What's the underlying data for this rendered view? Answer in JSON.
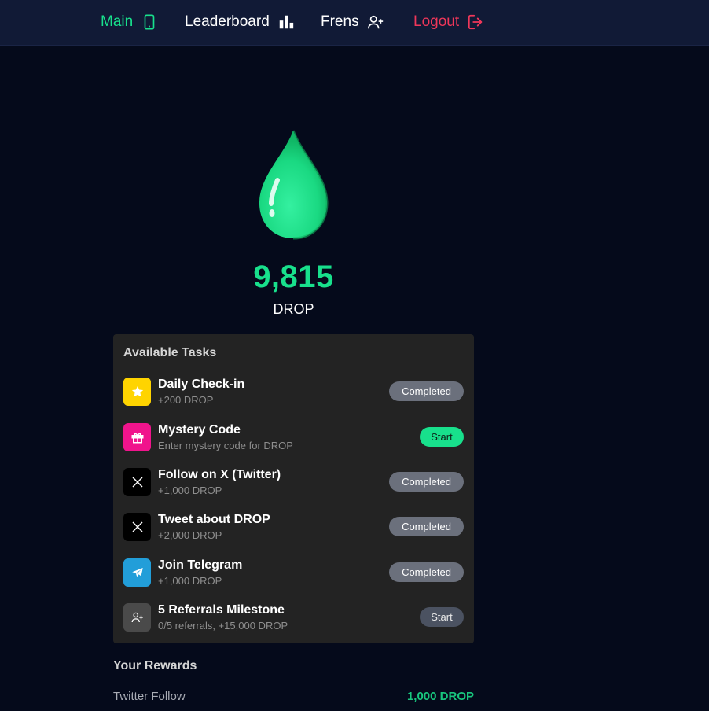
{
  "nav": {
    "main": "Main",
    "leaderboard": "Leaderboard",
    "frens": "Frens",
    "logout": "Logout"
  },
  "balance": {
    "amount": "9,815",
    "unit": "DROP"
  },
  "tasks": {
    "title": "Available Tasks",
    "items": [
      {
        "name": "Daily Check-in",
        "reward": "+200 DROP",
        "button": "Completed",
        "icon": "star-icon",
        "color": "#ffd400"
      },
      {
        "name": "Mystery Code",
        "reward": "Enter mystery code for DROP",
        "button": "Start",
        "icon": "gift-icon",
        "color": "#f0148c"
      },
      {
        "name": "Follow on X (Twitter)",
        "reward": "+1,000 DROP",
        "button": "Completed",
        "icon": "x-logo-icon",
        "color": "#000000"
      },
      {
        "name": "Tweet about DROP",
        "reward": "+2,000 DROP",
        "button": "Completed",
        "icon": "x-logo-icon",
        "color": "#000000"
      },
      {
        "name": "Join Telegram",
        "reward": "+1,000 DROP",
        "button": "Completed",
        "icon": "telegram-icon",
        "color": "#229ed9"
      },
      {
        "name": "5 Referrals Milestone",
        "reward": "0/5 referrals, +15,000 DROP",
        "button": "Start",
        "icon": "users-icon",
        "color": "#4a4a4a"
      }
    ]
  },
  "rewards": {
    "title": "Your Rewards",
    "items": [
      {
        "name": "Twitter Follow",
        "value": "1,000 DROP"
      }
    ]
  },
  "colors": {
    "accent": "#18e08c",
    "logout": "#f0375a",
    "background": "#050a1b",
    "panel": "#232323"
  }
}
